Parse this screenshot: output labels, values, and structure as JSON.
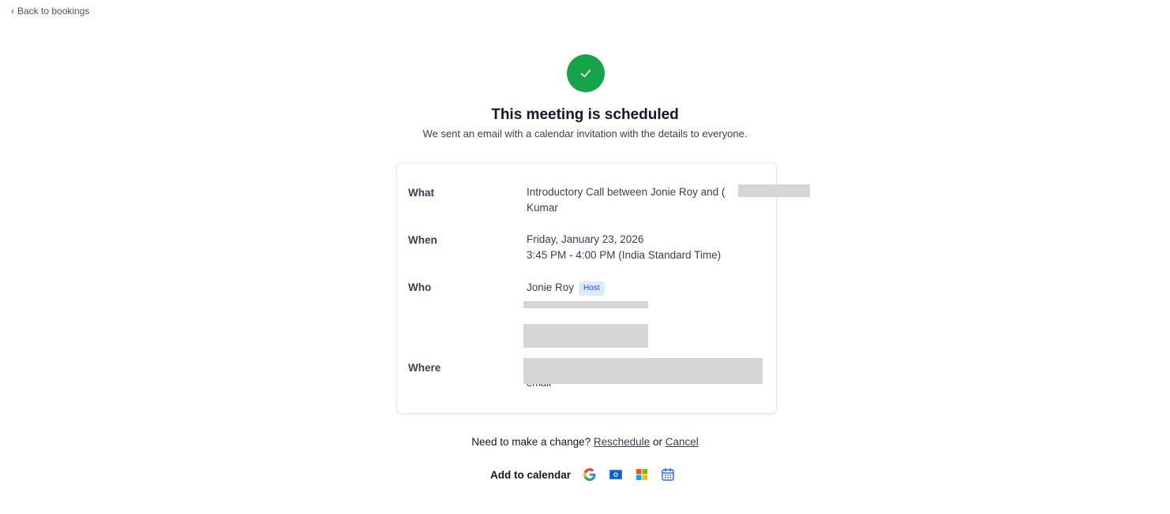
{
  "nav": {
    "back_label": "Back to bookings"
  },
  "header": {
    "title": "This meeting is scheduled",
    "subtitle": "We sent an email with a calendar invitation with the details to everyone."
  },
  "details": {
    "what": {
      "label": "What",
      "value_line1": "Introductory Call between Jonie Roy and (",
      "value_line2": "Kumar"
    },
    "when": {
      "label": "When",
      "date": "Friday, January 23, 2026",
      "time": "3:45 PM - 4:00 PM (India Standard Time)"
    },
    "who": {
      "label": "Who",
      "host_name": "Jonie Roy",
      "host_badge": "Host"
    },
    "where": {
      "label": "Where",
      "value_tail": "email"
    }
  },
  "change": {
    "prompt": "Need to make a change?",
    "reschedule_label": "Reschedule",
    "or_text": "or",
    "cancel_label": "Cancel"
  },
  "calendar": {
    "label": "Add to calendar",
    "icons": [
      "google-calendar-icon",
      "outlook-icon",
      "microsoft-365-icon",
      "ics-calendar-icon"
    ]
  },
  "colors": {
    "success": "#16a34a",
    "badge_bg": "#dbeafe",
    "badge_text": "#1d4ed8",
    "redaction": "#d6d6d6"
  }
}
